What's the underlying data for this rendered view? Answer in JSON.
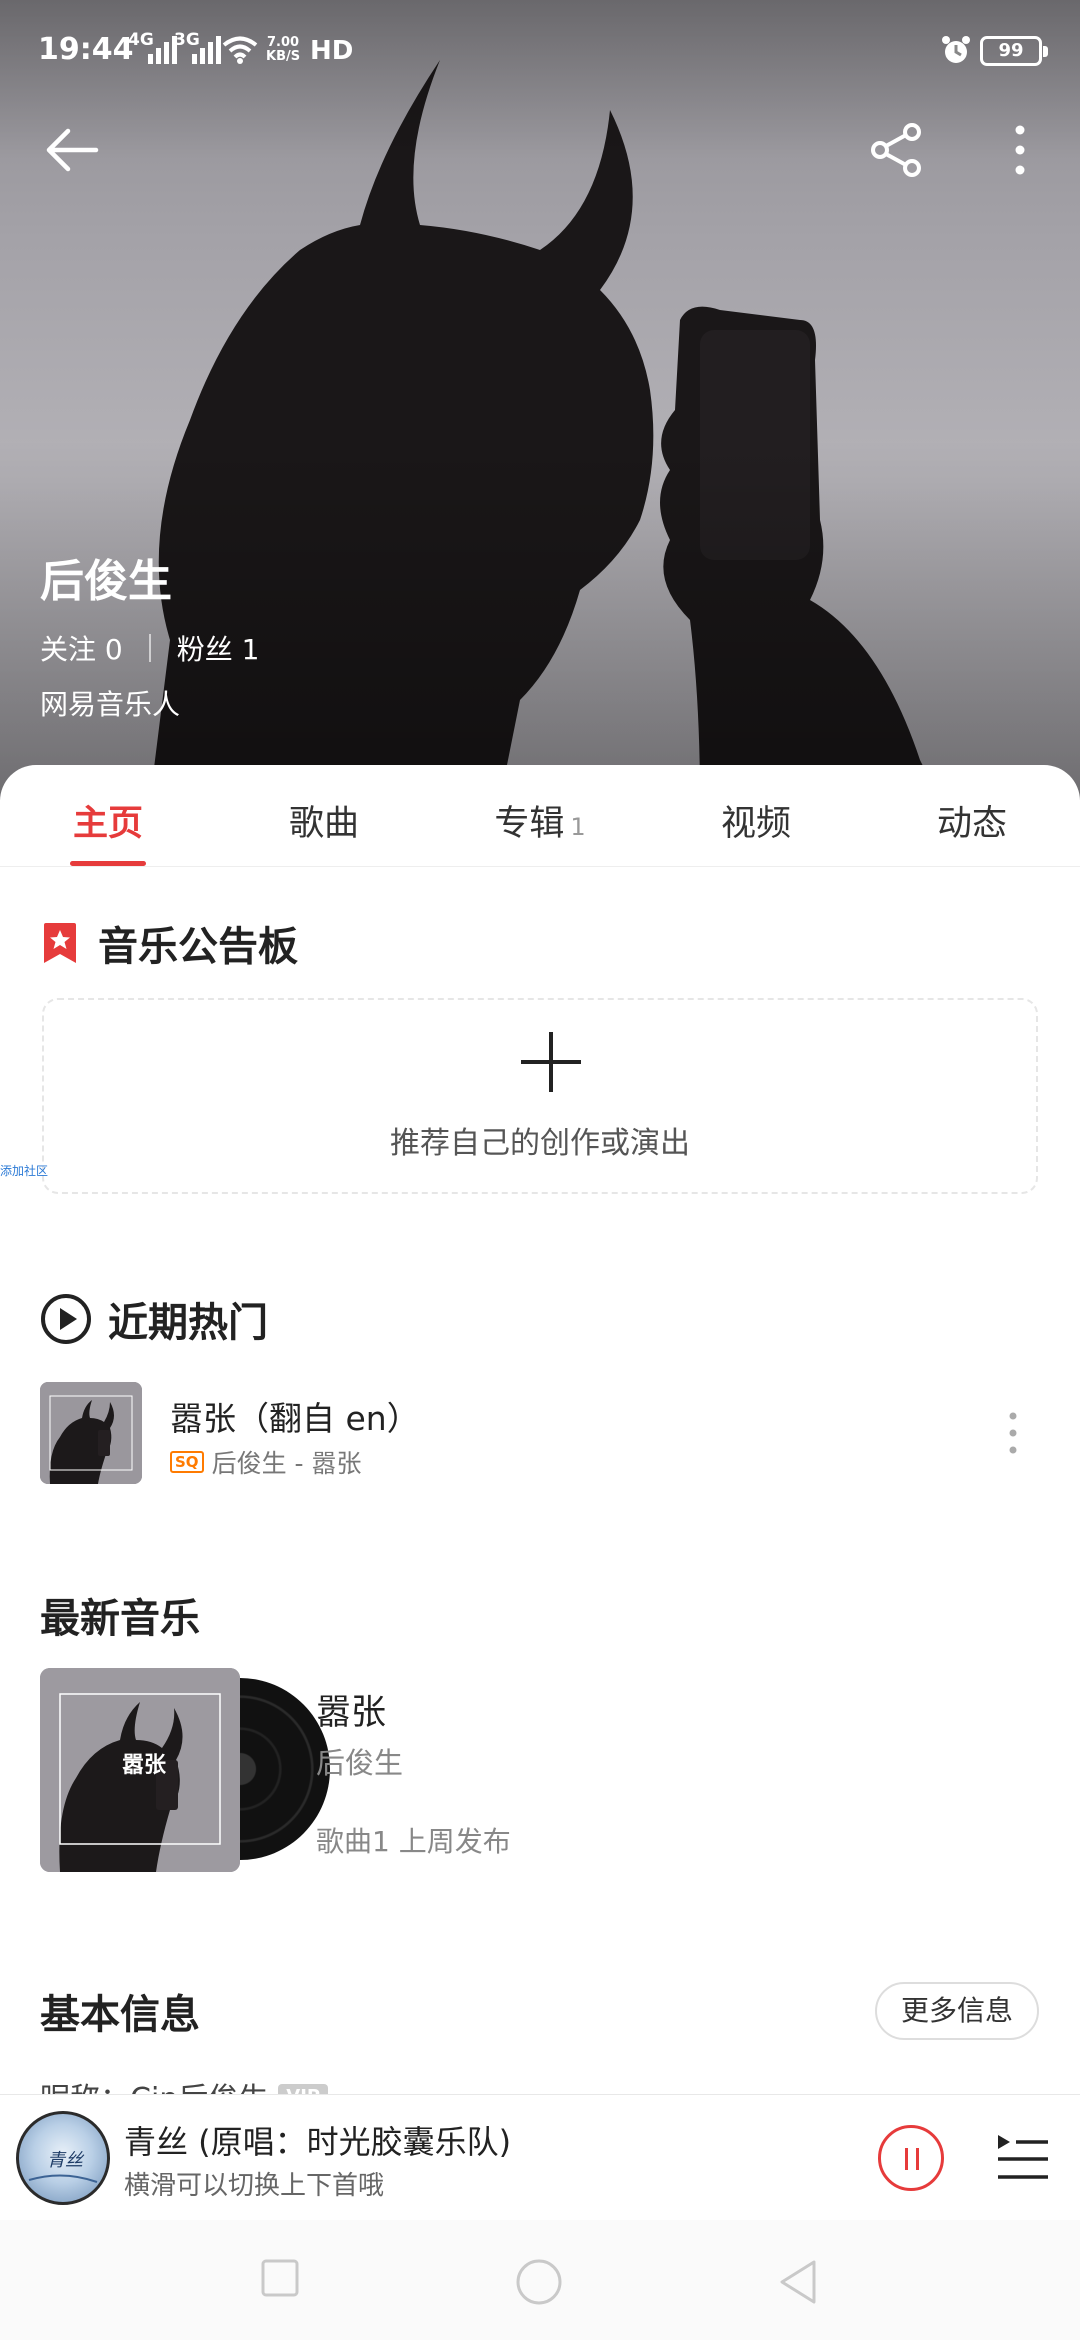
{
  "status_bar": {
    "time": "19:44",
    "signal1": "4G",
    "signal2": "3G",
    "speed_value": "7.00",
    "speed_unit": "KB/S",
    "hd": "HD",
    "battery": "99"
  },
  "header": {
    "back_icon": "arrow-left-icon",
    "share_icon": "share-icon",
    "more_icon": "more-vertical-icon"
  },
  "profile": {
    "name": "后俊生",
    "following_label": "关注",
    "following_count": "0",
    "followers_label": "粉丝",
    "followers_count": "1",
    "role": "网易音乐人"
  },
  "tabs": [
    {
      "label": "主页",
      "count": ""
    },
    {
      "label": "歌曲",
      "count": ""
    },
    {
      "label": "专辑",
      "count": "1"
    },
    {
      "label": "视频",
      "count": ""
    },
    {
      "label": "动态",
      "count": ""
    }
  ],
  "board": {
    "title": "音乐公告板",
    "add_text": "推荐自己的创作或演出",
    "side_link": "添加社区"
  },
  "hot": {
    "title": "近期热门",
    "song_title": "嚣张（翻自 en）",
    "quality_badge": "SQ",
    "song_sub": "后俊生 - 嚣张"
  },
  "latest": {
    "title": "最新音乐",
    "cover_text": "嚣张",
    "album_title": "嚣张",
    "album_artist": "后俊生",
    "album_meta": "歌曲1 上周发布"
  },
  "basic_info": {
    "title": "基本信息",
    "more_button": "更多信息",
    "nickname": "昵称：Cin后俊生",
    "vip_tag": "VIP"
  },
  "player": {
    "disc_text": "青丝",
    "title": "青丝 (原唱：时光胶囊乐队)",
    "hint": "横滑可以切换上下首哦"
  },
  "colors": {
    "accent": "#e63b3b",
    "badge_orange": "#ff7b00"
  }
}
